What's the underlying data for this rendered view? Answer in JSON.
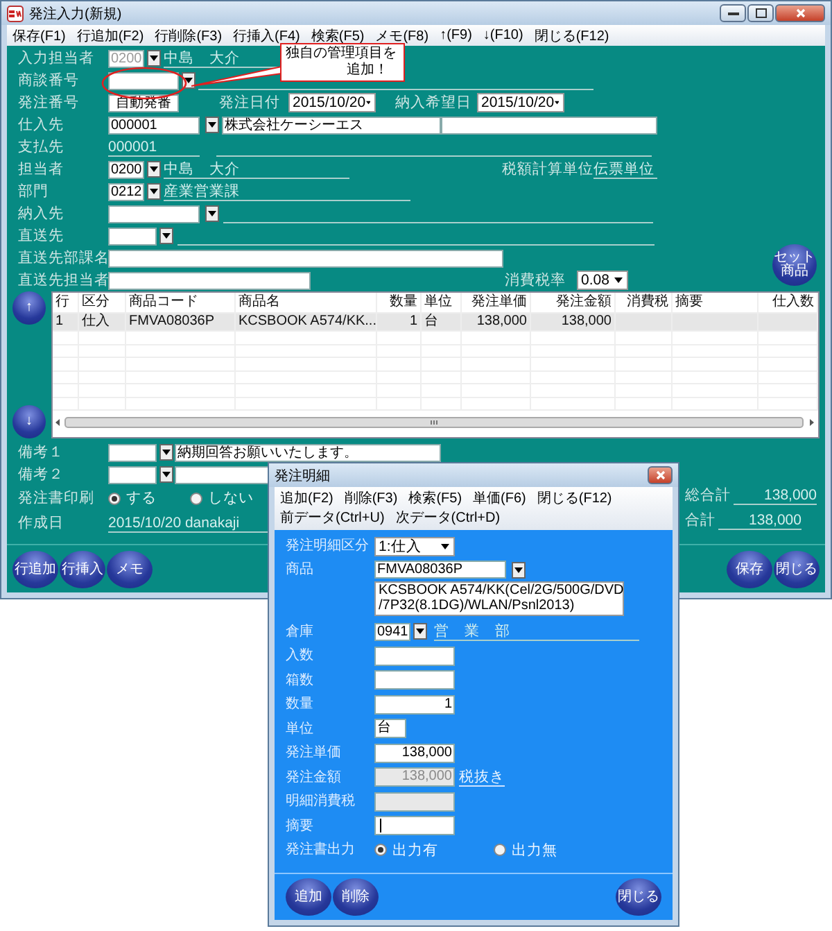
{
  "window": {
    "title": "発注入力(新規)"
  },
  "menu": [
    "保存(F1)",
    "行追加(F2)",
    "行削除(F3)",
    "行挿入(F4)",
    "検索(F5)",
    "メモ(F8)",
    "↑(F9)",
    "↓(F10)",
    "閉じる(F12)"
  ],
  "callout": {
    "lines": [
      "独自の管理項目を",
      "追加！"
    ]
  },
  "form": [
    {
      "label": "入力担当者",
      "fields": [
        {
          "kind": "code",
          "value": "0200",
          "disabled": true
        },
        {
          "kind": "dropdown"
        },
        {
          "kind": "name",
          "text": "中島　大介"
        }
      ]
    },
    {
      "label": "商談番号",
      "fields": [
        {
          "kind": "code"
        },
        {
          "kind": "dropdown"
        },
        {
          "kind": "name"
        }
      ]
    },
    {
      "label": "発注番号",
      "fields": [
        {
          "kind": "code",
          "value": "自動発番"
        },
        {
          "kind": "caption",
          "text": "発注日付"
        },
        {
          "kind": "date",
          "value": "2015/10/20"
        },
        {
          "kind": "caption",
          "text": "納入希望日"
        },
        {
          "kind": "date",
          "value": "2015/10/20"
        }
      ]
    },
    {
      "label": "仕入先",
      "fields": [
        {
          "kind": "code",
          "value": "000001"
        },
        {
          "kind": "dropdown"
        },
        {
          "kind": "code",
          "value": "株式会社ケーシーエス"
        },
        {
          "kind": "code"
        }
      ]
    },
    {
      "label": "支払先",
      "fields": [
        {
          "kind": "name",
          "text": "000001"
        },
        {
          "kind": "name"
        }
      ]
    },
    {
      "label": "担当者",
      "fields": [
        {
          "kind": "code",
          "value": "0200"
        },
        {
          "kind": "dropdown"
        },
        {
          "kind": "name",
          "text": "中島　大介"
        },
        {
          "kind": "caption",
          "text": "税額計算単位"
        },
        {
          "kind": "name",
          "text": "伝票単位"
        }
      ]
    },
    {
      "label": "部門",
      "fields": [
        {
          "kind": "code",
          "value": "0212"
        },
        {
          "kind": "dropdown"
        },
        {
          "kind": "name",
          "text": "産業営業課"
        }
      ]
    },
    {
      "label": "納入先",
      "fields": [
        {
          "kind": "code"
        },
        {
          "kind": "dropdown"
        },
        {
          "kind": "name"
        }
      ]
    },
    {
      "label": "直送先",
      "fields": [
        {
          "kind": "code"
        },
        {
          "kind": "dropdown"
        },
        {
          "kind": "name"
        }
      ]
    },
    {
      "label": "直送先部課名",
      "fields": [
        {
          "kind": "code"
        }
      ]
    },
    {
      "label": "直送先担当者",
      "fields": [
        {
          "kind": "code"
        },
        {
          "kind": "caption",
          "text": "消費税率"
        },
        {
          "kind": "select",
          "value": "0.08"
        }
      ]
    }
  ],
  "set_button": "セット商品",
  "scroll_buttons": [
    "↑",
    "↓"
  ],
  "grid": {
    "columns": [
      {
        "label": "行"
      },
      {
        "label": "区分"
      },
      {
        "label": "商品コード"
      },
      {
        "label": "商品名"
      },
      {
        "label": "数量",
        "numeric": true
      },
      {
        "label": "単位"
      },
      {
        "label": "発注単価",
        "numeric": true
      },
      {
        "label": "発注金額",
        "numeric": true
      },
      {
        "label": "消費税",
        "numeric": true
      },
      {
        "label": "摘要"
      },
      {
        "label": "仕入数",
        "numeric": true
      }
    ],
    "rows": [
      {
        "selected": true,
        "cells": [
          "1",
          "仕入",
          "FMVA08036P",
          "KCSBOOK A574/KK...",
          "1",
          "台",
          "138,000",
          "138,000"
        ]
      }
    ]
  },
  "remarks": [
    {
      "label": "備考１",
      "text": "納期回答お願いいたします。"
    },
    {
      "label": "備考２"
    }
  ],
  "print_option": {
    "label": "発注書印刷",
    "options": [
      {
        "label": "する",
        "selected": true
      },
      {
        "label": "しない",
        "selected": false
      }
    ]
  },
  "created": {
    "label": "作成日",
    "value": "2015/10/20 danakaji"
  },
  "totals": [
    {
      "label": "総合計",
      "value": "138,000"
    },
    {
      "label": "合計",
      "value": "138,000"
    }
  ],
  "buttons_left": [
    "行追加",
    "行挿入",
    "メモ"
  ],
  "buttons_right": [
    "保存",
    "閉じる"
  ],
  "dialog": {
    "title": "発注明細",
    "menu": [
      "追加(F2)",
      "削除(F3)",
      "検索(F5)",
      "単価(F6)",
      "閉じる(F12)",
      "前データ(Ctrl+U)",
      "次データ(Ctrl+D)"
    ],
    "fields": [
      {
        "label": "発注明細区分",
        "kind": "select",
        "value": "1:仕入"
      },
      {
        "label": "商品",
        "kind": "product",
        "code": "FMVA08036P",
        "name_lines": [
          "KCSBOOK A574/KK(Cel/2G/500G/DVD",
          "/7P32(8.1DG)/WLAN/Psnl2013)"
        ]
      },
      {
        "label": "倉庫",
        "kind": "lookup",
        "code": "0941",
        "name": "営　業　部"
      },
      {
        "label": "入数",
        "kind": "input"
      },
      {
        "label": "箱数",
        "kind": "input"
      },
      {
        "label": "数量",
        "kind": "input",
        "value": "1",
        "numeric": true
      },
      {
        "label": "単位",
        "kind": "unit",
        "value": "台"
      },
      {
        "label": "発注単価",
        "kind": "input",
        "value": "138,000",
        "numeric": true
      },
      {
        "label": "発注金額",
        "kind": "input",
        "value": "138,000",
        "numeric": true,
        "disabled": true,
        "note": "税抜き"
      },
      {
        "label": "明細消費税",
        "kind": "input",
        "disabled": true
      },
      {
        "label": "摘要",
        "kind": "input",
        "focused": true
      },
      {
        "label": "発注書出力",
        "kind": "radio",
        "options": [
          {
            "label": "出力有",
            "selected": true
          },
          {
            "label": "出力無",
            "selected": false
          }
        ]
      }
    ],
    "buttons_left": [
      "追加",
      "削除"
    ],
    "buttons_right": [
      "閉じる"
    ]
  }
}
